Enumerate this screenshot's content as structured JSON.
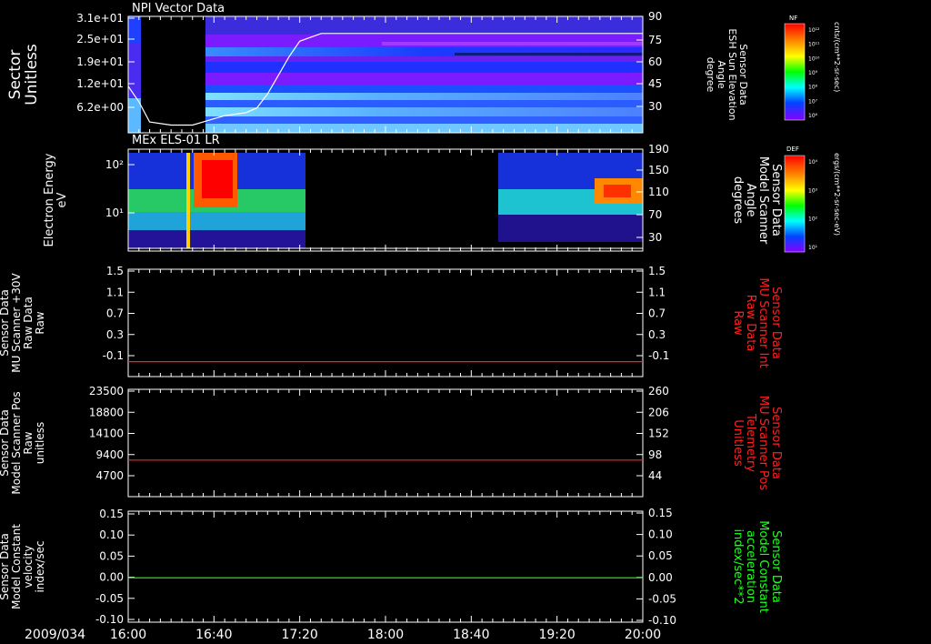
{
  "chart_data": [
    {
      "type": "heatmap",
      "title": "NPI Vector Data",
      "ylabel_left": [
        "Sector",
        "Unitless"
      ],
      "yticks_left": [
        "3.1e+01",
        "2.5e+01",
        "1.9e+01",
        "1.2e+01",
        "6.2e+00"
      ],
      "ylabel_right": [
        "Sensor Data",
        "ESH Sun Elevation",
        "Angle",
        "degree"
      ],
      "yticks_right": [
        "90",
        "75",
        "60",
        "45",
        "30"
      ],
      "ylim_right": [
        15,
        90
      ],
      "colorbar": {
        "label": "NF",
        "units": "cnts/(cm**2-sr-sec)",
        "ticks": [
          "10¹²",
          "10¹¹",
          "10¹⁰",
          "10⁹",
          "10⁸",
          "10⁷",
          "10⁶"
        ]
      },
      "line_series": {
        "name": "ESH Sun Elevation Angle",
        "color": "#ffffff",
        "x_min": [
          0,
          5,
          10,
          20,
          30,
          40,
          45,
          50,
          55,
          60,
          65,
          70,
          75,
          80,
          90,
          100,
          120,
          140,
          160,
          200,
          240
        ],
        "y": [
          45,
          35,
          22,
          20,
          20,
          24,
          26,
          27,
          28,
          31,
          40,
          52,
          64,
          74,
          79,
          79,
          79,
          79,
          79,
          79,
          79
        ]
      }
    },
    {
      "type": "heatmap",
      "title": "MEx ELS-01 LR",
      "ylabel_left": [
        "Electron Energy",
        "eV"
      ],
      "yticks_left": [
        "10²",
        "10¹"
      ],
      "ylabel_right": [
        "Sensor Data",
        "Model Scanner",
        "Angle",
        "degrees"
      ],
      "yticks_right": [
        "190",
        "150",
        "110",
        "70",
        "30"
      ],
      "data_gap": [
        "17:21",
        "18:49"
      ],
      "colorbar": {
        "label": "DEF",
        "units": "ergs/(cm**2-sr-sec-eV)",
        "ticks": [
          "10⁴",
          "10³",
          "10²",
          "10¹"
        ]
      }
    },
    {
      "type": "line",
      "ylabel_left": [
        "Sensor Data",
        "MU Scanner +30V",
        "Raw Data",
        "Raw"
      ],
      "yticks_left": [
        "1.5",
        "1.1",
        "0.7",
        "0.3",
        "-0.1"
      ],
      "ylabel_right": [
        "Sensor Data",
        "MU Scanner Int",
        "Raw Data",
        "Raw"
      ],
      "yticks_right": [
        "1.5",
        "1.1",
        "0.7",
        "0.3",
        "-0.1"
      ],
      "ylim": [
        -0.3,
        1.5
      ],
      "series": [
        {
          "color": "#ff2020",
          "value": -0.05
        }
      ]
    },
    {
      "type": "line",
      "ylabel_left": [
        "Sensor Data",
        "Model Scanner Pos",
        "Raw",
        "unitless"
      ],
      "yticks_left": [
        "23500",
        "18800",
        "14100",
        "9400",
        "4700"
      ],
      "ylabel_right": [
        "Sensor Data",
        "MU Scanner Pos",
        "Telemetry",
        "Unitless"
      ],
      "yticks_right": [
        "260",
        "206",
        "152",
        "98",
        "44"
      ],
      "ylim": [
        0,
        23500
      ],
      "series": [
        {
          "color": "#ff2020",
          "value": 8000
        }
      ]
    },
    {
      "type": "line",
      "ylabel_left": [
        "Sensor Data",
        "Model Constant",
        "velocity",
        "index/sec"
      ],
      "yticks_left": [
        "0.15",
        "0.10",
        "0.05",
        "0.00",
        "-0.05",
        "-0.10"
      ],
      "ylabel_right": [
        "Sensor Data",
        "Model Constant",
        "acceleration",
        "index/sec**2"
      ],
      "yticks_right": [
        "0.15",
        "0.10",
        "0.05",
        "0.00",
        "-0.05",
        "-0.10"
      ],
      "ylim": [
        -0.1,
        0.15
      ],
      "series": [
        {
          "color": "#20ff20",
          "value": 0.0
        }
      ]
    }
  ],
  "x_axis": {
    "date": "2009/034",
    "ticks": [
      "16:00",
      "16:40",
      "17:20",
      "18:00",
      "18:40",
      "19:20",
      "20:00"
    ],
    "range": [
      "16:00",
      "20:00"
    ]
  },
  "colors": {
    "background": "#000000",
    "axes": "#ffffff",
    "red_label": "#ff2020",
    "green_label": "#20ff20"
  }
}
